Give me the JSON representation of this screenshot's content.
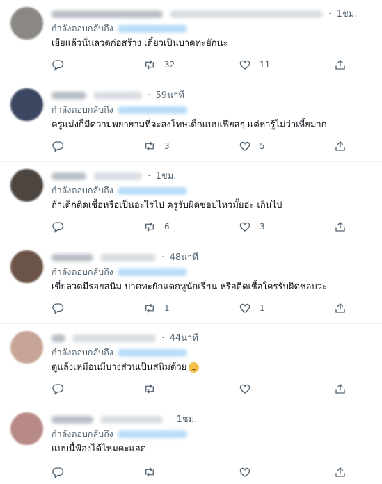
{
  "reply_prefix": "กำลังตอบกลับถึง",
  "tweets": [
    {
      "time": "1ชม.",
      "text": "เย้ยแล้วนั่นลวดก่อสร้าง เดี๋ยวเป็นบาดทะยักนะ",
      "retweets": "32",
      "likes": "11",
      "avatar_color": "#8a8784"
    },
    {
      "time": "59นาที",
      "text": "ครูแม่งก็มีความพยายามที่จะลงโทษเด็กแบบเฟียสๆ แต่หารู้ไม่ว่าเหี้ยมาก",
      "retweets": "3",
      "likes": "5",
      "avatar_color": "#3b4760"
    },
    {
      "time": "1ชม.",
      "text": "ถ้าเด็กติดเชื้อหรือเป็นอะไรไป ครูรับผิดชอบไหวมั้ยอ่ะ เกินไป",
      "retweets": "6",
      "likes": "3",
      "avatar_color": "#4c4540"
    },
    {
      "time": "48นาที",
      "text": "เขี่ยลวดมีรอยสนิม บาดทะยักแดกหูนักเรียน หรือติดเชื้อใครรับผิดชอบวะ",
      "retweets": "1",
      "likes": "1",
      "avatar_color": "#6b5447"
    },
    {
      "time": "44นาที",
      "text": "ดูแล้งเหมือนมีบางส่วนเป็นสนิมด้วย",
      "retweets": "",
      "likes": "",
      "avatar_color": "#c7a596"
    },
    {
      "time": "1ชม.",
      "text": "แบบนี้ฟ้องได้ไหมคะแอด",
      "retweets": "",
      "likes": "",
      "avatar_color": "#b88a86"
    }
  ],
  "icons": {
    "reply": "reply-icon",
    "retweet": "retweet-icon",
    "like": "heart-icon",
    "share": "share-icon",
    "emoji": "disappointed-face-emoji"
  }
}
